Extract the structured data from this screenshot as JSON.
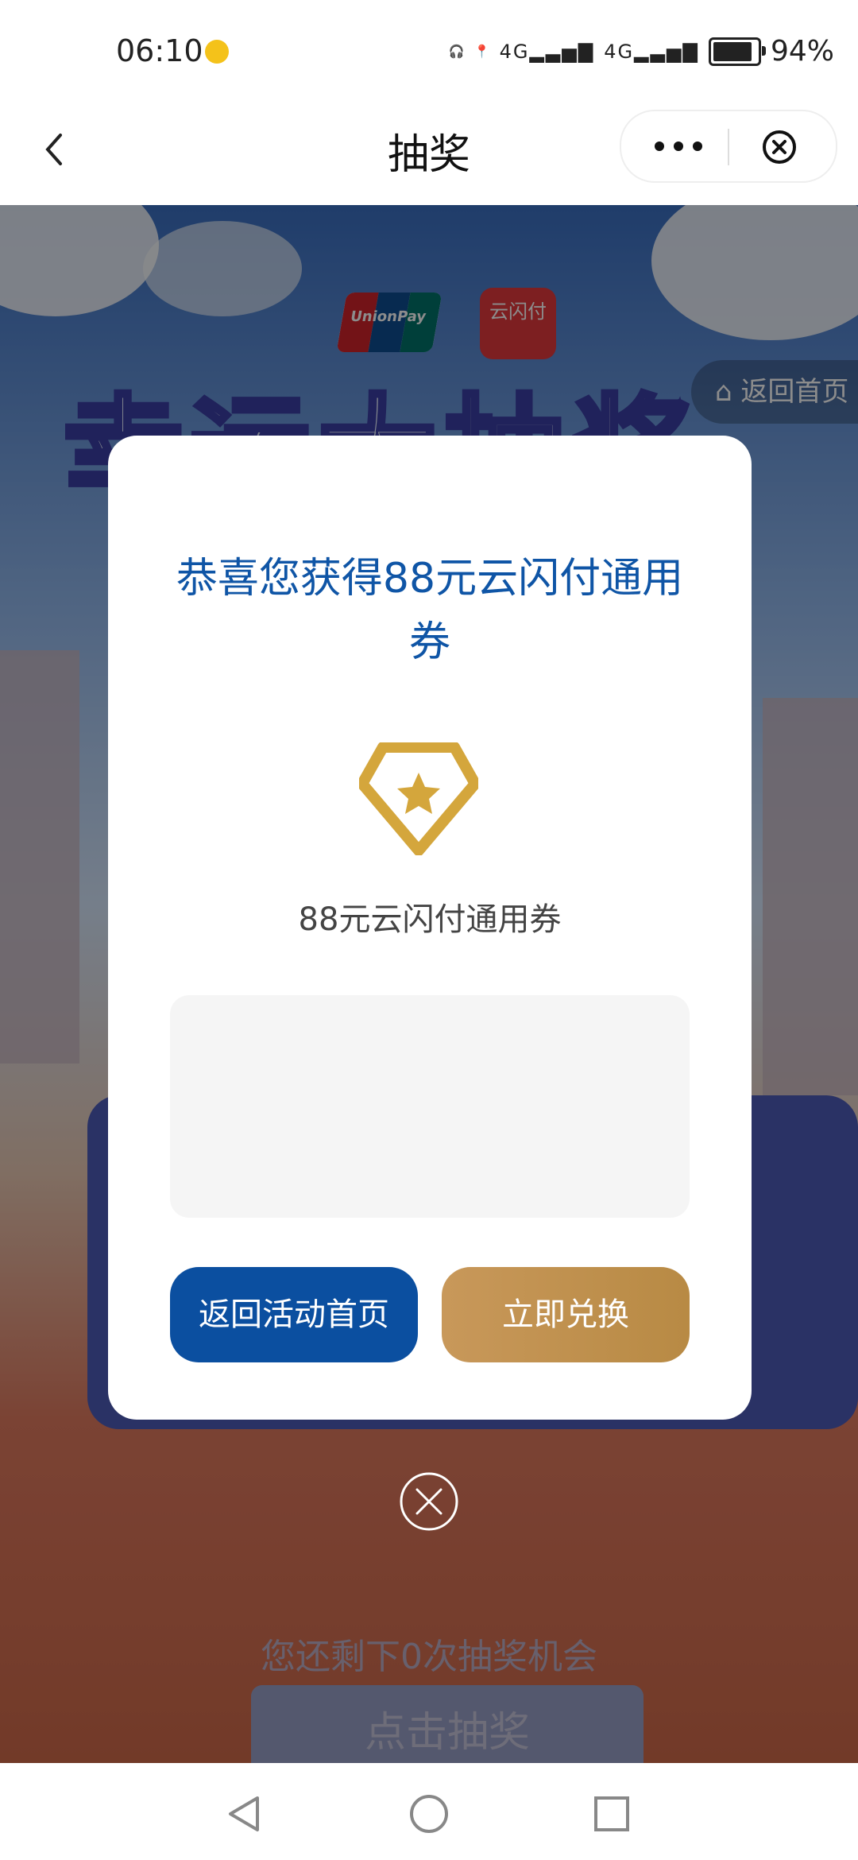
{
  "status_bar": {
    "time": "06:10",
    "signal_1": "4G",
    "signal_2": "4G",
    "battery_percent": "94%"
  },
  "nav": {
    "title": "抽奖",
    "back_icon": "chevron-left-icon",
    "more_icon": "more-dots-icon",
    "close_icon": "close-circle-icon"
  },
  "background_page": {
    "logo_unionpay": "UnionPay",
    "logo_yunshanfu": "云闪付",
    "banner_title": "幸运大抽奖",
    "home_link": "返回首页",
    "remaining_text": "您还剩下0次抽奖机会",
    "draw_button": "点击抽奖"
  },
  "modal": {
    "title": "恭喜您获得88元云闪付通用券",
    "prize_icon": "diamond-star-icon",
    "prize_name": "88元云闪付通用券",
    "back_button": "返回活动首页",
    "redeem_button": "立即兑换",
    "close_icon": "close-circle-icon"
  },
  "colors": {
    "title_blue": "#0f55a6",
    "button_blue": "#0b4fa0",
    "button_gold": "#c8985a",
    "icon_gold": "#d4a63c"
  }
}
